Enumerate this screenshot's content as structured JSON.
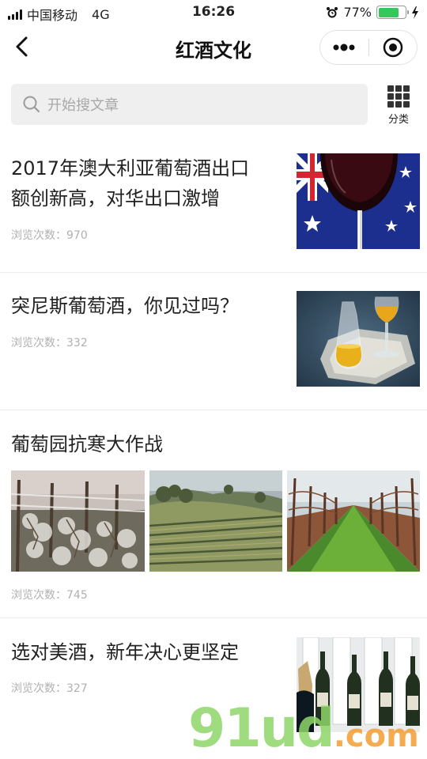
{
  "status_bar": {
    "carrier": "中国移动",
    "network": "4G",
    "time": "16:26",
    "battery": "77%",
    "battery_level": 0.77,
    "battery_color": "#34c759"
  },
  "nav": {
    "title": "红酒文化",
    "back_icon": "chevron-left-icon",
    "more_icon": "more-dots-icon",
    "close_icon": "target-close-icon"
  },
  "search": {
    "placeholder": "开始搜文章",
    "category_label": "分类"
  },
  "articles": [
    {
      "title_lines": [
        "2017年澳大利亚葡萄酒出口",
        "额创新高，对华出口激增"
      ],
      "views": "浏览次数：970",
      "image": "wine-glass-australian-flag"
    },
    {
      "title_lines": [
        "突尼斯葡萄酒，你见过吗？"
      ],
      "views": "浏览次数：332",
      "image": "glasses-of-wine-on-doily"
    },
    {
      "title_lines": [
        "葡萄园抗寒大作战"
      ],
      "views": "浏览次数：745",
      "images": [
        "frosted-vines",
        "vineyard-hills",
        "vine-rows-grass"
      ]
    },
    {
      "title_lines": [
        "选对美酒，新年决心更坚定"
      ],
      "views": "浏览次数：327",
      "image": "wine-bottles-shelf"
    }
  ],
  "watermark": {
    "main": "91ud",
    "suffix": ".com"
  }
}
